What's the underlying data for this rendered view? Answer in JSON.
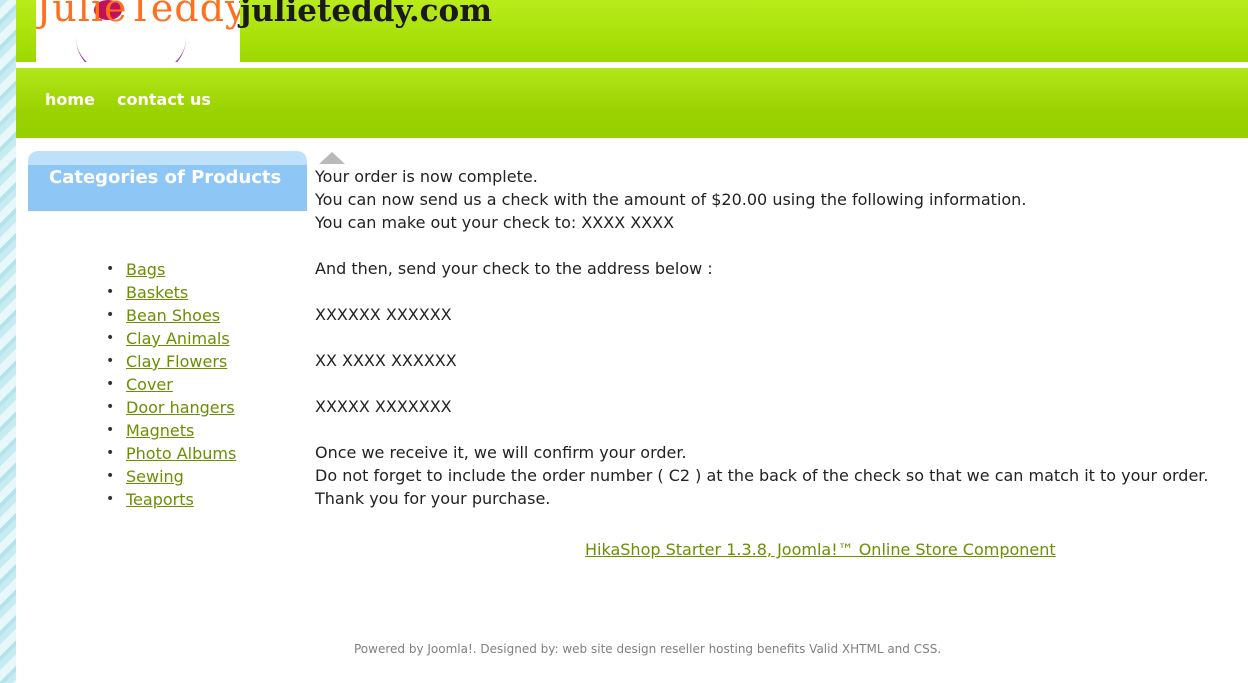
{
  "header": {
    "logo_text": "JulieTeddy",
    "site_name": "julieteddy.com"
  },
  "nav": {
    "items": [
      {
        "label": "home"
      },
      {
        "label": "contact us"
      }
    ]
  },
  "sidebar": {
    "title": "Categories of Products",
    "categories": [
      {
        "label": "Bags"
      },
      {
        "label": "Baskets"
      },
      {
        "label": "Bean Shoes"
      },
      {
        "label": "Clay Animals"
      },
      {
        "label": "Clay Flowers"
      },
      {
        "label": "Cover"
      },
      {
        "label": "Door hangers"
      },
      {
        "label": "Magnets"
      },
      {
        "label": "Photo Albums"
      },
      {
        "label": "Sewing"
      },
      {
        "label": "Teaports"
      }
    ]
  },
  "main": {
    "line1": "Your order is now complete.",
    "line2": "You can now send us a check with the amount of $20.00 using the following information.",
    "line3": "You can make out your check to: XXXX XXXX",
    "line4": "And then, send your check to the address below :",
    "address1": "XXXXXX XXXXXX",
    "address2": "XX XXXX XXXXXX",
    "address3": "XXXXX XXXXXXX",
    "line5": "Once we receive it, we will confirm your order.",
    "line6": "Do not forget to include the order number ( C2 ) at the back of the check so that we can match it to your order.",
    "line7": "Thank you for your purchase."
  },
  "hikashop_link": "HikaShop Starter 1.3.8, Joomla!™ Online Store Component",
  "footer": "Powered by Joomla!. Designed by: web site design reseller hosting benefits Valid XHTML and CSS.",
  "colors": {
    "header_green": "#9ed800",
    "link_green": "#6b8f00",
    "sidebar_blue": "#8ec6f6"
  }
}
